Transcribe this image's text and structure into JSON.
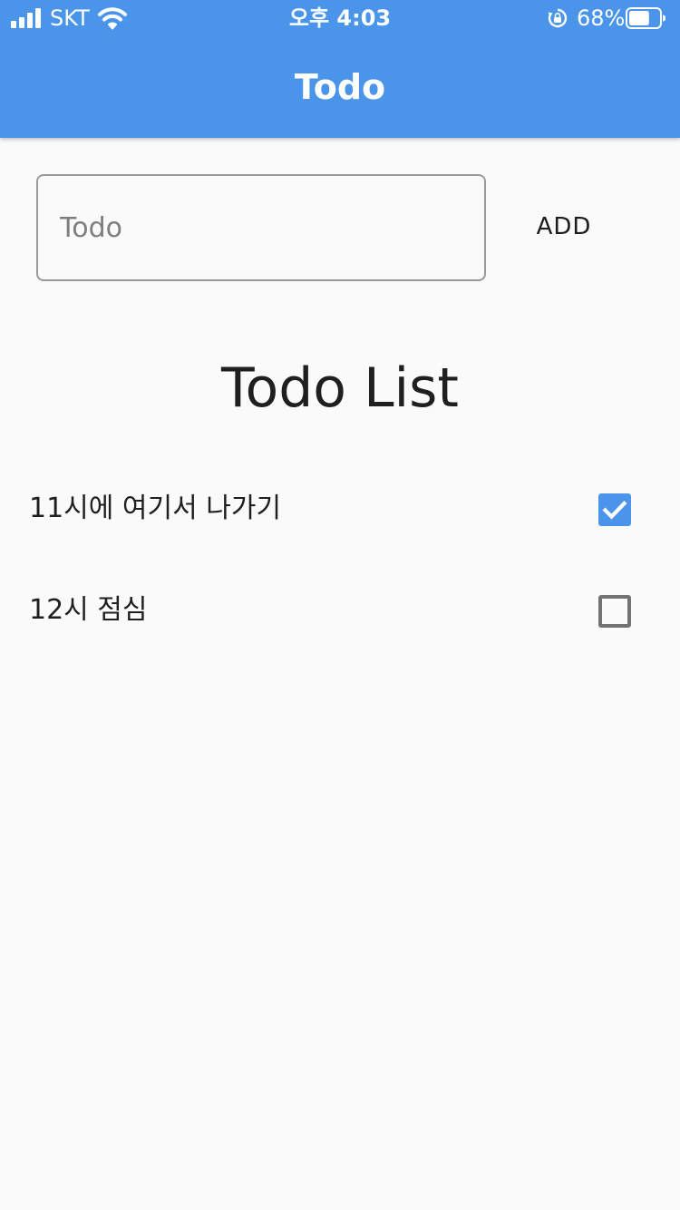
{
  "status_bar": {
    "carrier": "SKT",
    "time": "오후 4:03",
    "battery_percent": "68%",
    "battery_level": 0.68,
    "icons": [
      "signal-icon",
      "wifi-icon",
      "rotation-lock-icon",
      "battery-icon"
    ]
  },
  "app_bar": {
    "title": "Todo",
    "color": "#4a95e9"
  },
  "input": {
    "placeholder": "Todo",
    "value": ""
  },
  "add_button": {
    "label": "ADD"
  },
  "list": {
    "title": "Todo List",
    "items": [
      {
        "text": "11시에 여기서 나가기",
        "done": true
      },
      {
        "text": "12시 점심",
        "done": false
      }
    ]
  }
}
